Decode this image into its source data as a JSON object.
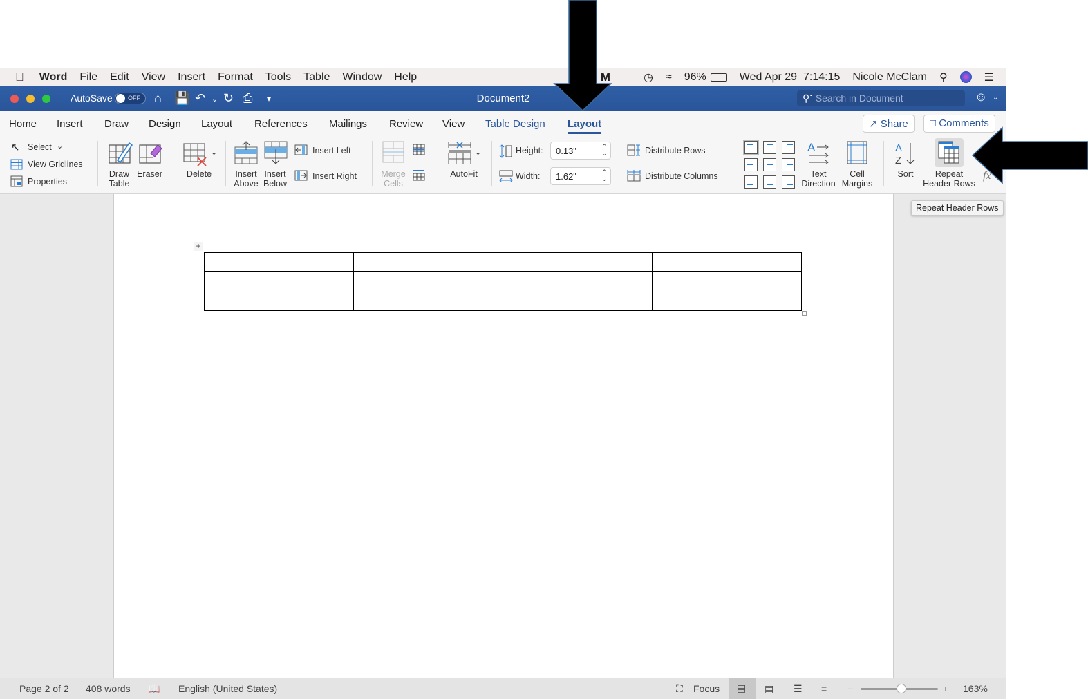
{
  "menubar": {
    "apple": "",
    "app": "Word",
    "items": [
      "File",
      "Edit",
      "View",
      "Insert",
      "Format",
      "Tools",
      "Table",
      "Window",
      "Help"
    ],
    "battery": "96%",
    "datetime": "Wed Apr 29  7:14:15",
    "user": "Nicole McClam"
  },
  "titlebar": {
    "autosave_label": "AutoSave",
    "autosave_state": "OFF",
    "doc_title": "Document2",
    "search_placeholder": "Search in Document"
  },
  "tabs": [
    {
      "label": "Home"
    },
    {
      "label": "Insert"
    },
    {
      "label": "Draw"
    },
    {
      "label": "Design"
    },
    {
      "label": "Layout"
    },
    {
      "label": "References"
    },
    {
      "label": "Mailings"
    },
    {
      "label": "Review"
    },
    {
      "label": "View"
    },
    {
      "label": "Table Design"
    },
    {
      "label": "Layout"
    }
  ],
  "share_label": "Share",
  "comments_label": "Comments",
  "ribbon": {
    "select": "Select",
    "view_gridlines": "View Gridlines",
    "properties": "Properties",
    "draw_table": "Draw Table",
    "eraser": "Eraser",
    "delete": "Delete",
    "insert_above": "Insert Above",
    "insert_below": "Insert Below",
    "insert_left": "Insert Left",
    "insert_right": "Insert Right",
    "merge_cells": "Merge Cells",
    "autofit": "AutoFit",
    "height_label": "Height:",
    "height_value": "0.13\"",
    "width_label": "Width:",
    "width_value": "1.62\"",
    "distribute_rows": "Distribute Rows",
    "distribute_columns": "Distribute Columns",
    "text_direction": "Text Direction",
    "cell_margins": "Cell Margins",
    "sort": "Sort",
    "repeat_header_rows": "Repeat Header Rows",
    "formula": "fx"
  },
  "tooltip": "Repeat Header Rows",
  "document": {
    "table": {
      "rows": 3,
      "cols": 4
    }
  },
  "status": {
    "page": "Page 2 of 2",
    "words": "408 words",
    "language": "English (United States)",
    "focus": "Focus",
    "zoom": "163%",
    "zoom_level_percent": 163
  }
}
